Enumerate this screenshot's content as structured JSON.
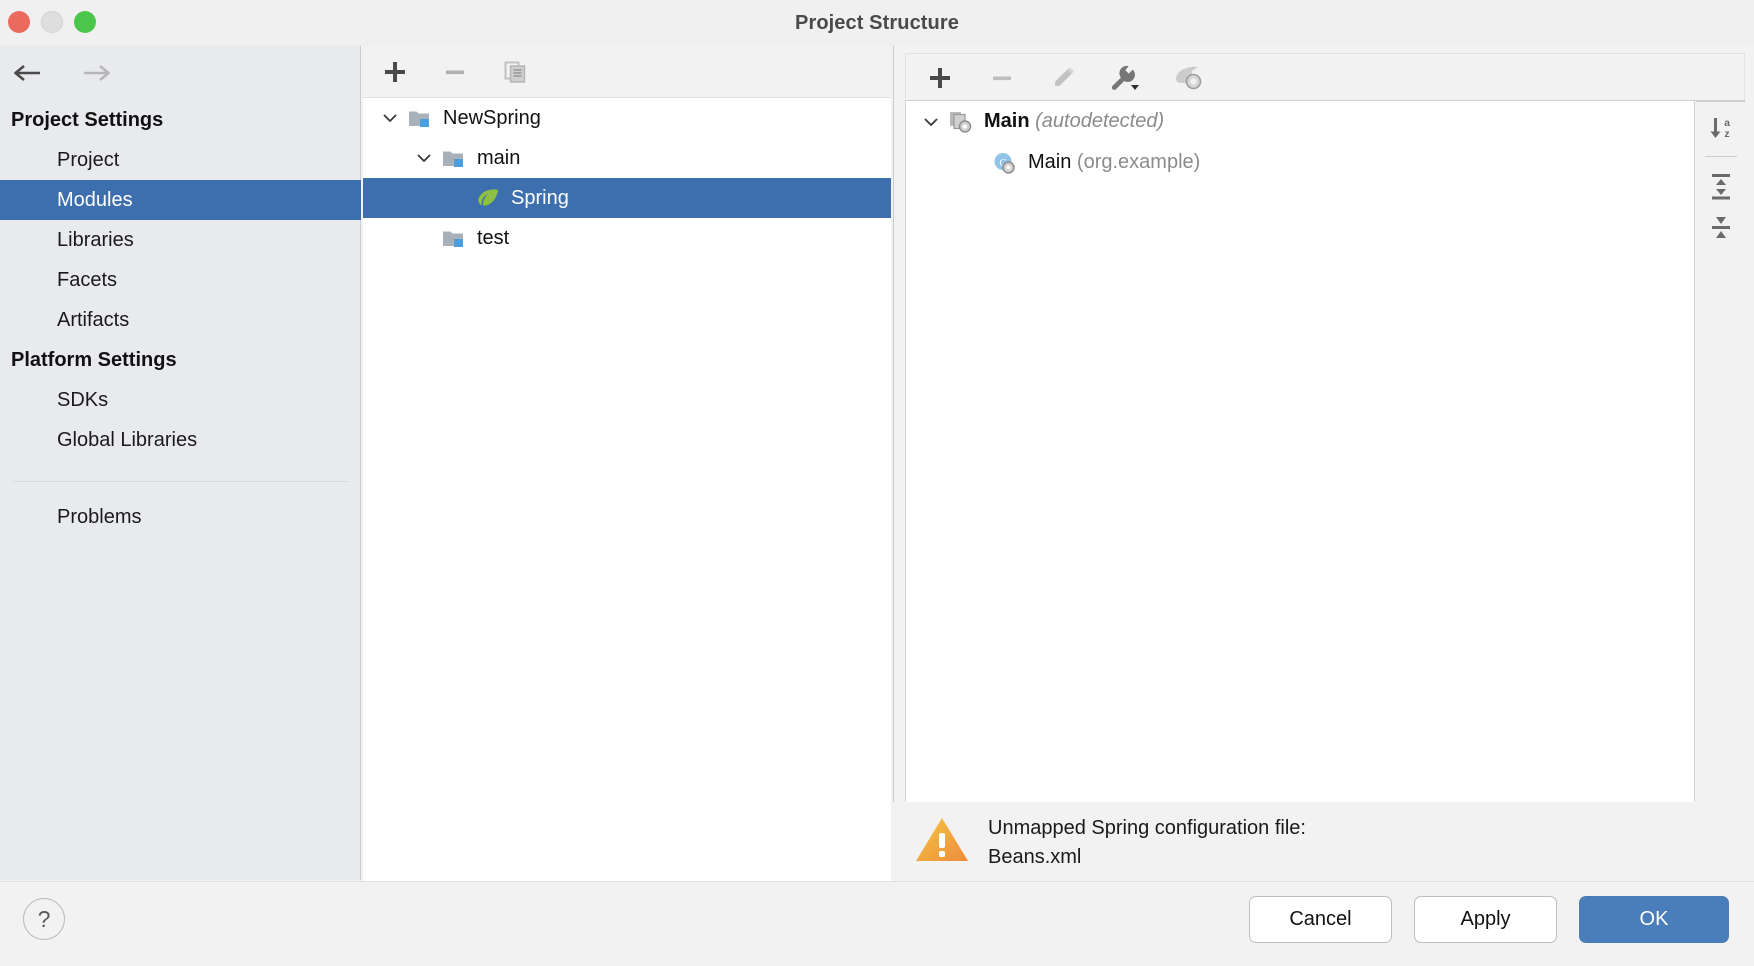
{
  "window": {
    "title": "Project Structure",
    "traffic_lights": [
      "close-button",
      "minimize-button",
      "maximize-button"
    ]
  },
  "nav": {
    "back_icon": "arrow-left-icon",
    "forward_icon": "arrow-right-icon"
  },
  "sidebar": {
    "groups": [
      {
        "title": "Project Settings",
        "items": [
          {
            "label": "Project",
            "selected": false
          },
          {
            "label": "Modules",
            "selected": true
          },
          {
            "label": "Libraries",
            "selected": false
          },
          {
            "label": "Facets",
            "selected": false
          },
          {
            "label": "Artifacts",
            "selected": false
          }
        ]
      },
      {
        "title": "Platform Settings",
        "items": [
          {
            "label": "SDKs",
            "selected": false
          },
          {
            "label": "Global Libraries",
            "selected": false
          }
        ]
      }
    ],
    "problems": {
      "label": "Problems",
      "selected": false
    }
  },
  "modules_panel": {
    "toolbar": [
      {
        "name": "add-module-button",
        "icon": "plus-icon",
        "enabled": true
      },
      {
        "name": "remove-module-button",
        "icon": "minus-icon",
        "enabled": false
      },
      {
        "name": "copy-module-button",
        "icon": "copy-icon",
        "enabled": false
      }
    ],
    "tree": [
      {
        "label": "NewSpring",
        "icon": "module-folder-icon",
        "depth": 0,
        "expanded": true,
        "selected": false
      },
      {
        "label": "main",
        "icon": "source-folder-icon",
        "depth": 1,
        "expanded": true,
        "selected": false
      },
      {
        "label": "Spring",
        "icon": "spring-leaf-icon",
        "depth": 2,
        "expanded": null,
        "selected": true
      },
      {
        "label": "test",
        "icon": "source-folder-icon",
        "depth": 1,
        "expanded": null,
        "selected": false
      }
    ]
  },
  "facet_panel": {
    "toolbar": [
      {
        "name": "add-fileset-button",
        "icon": "plus-icon",
        "enabled": true
      },
      {
        "name": "remove-fileset-button",
        "icon": "minus-icon",
        "enabled": false
      },
      {
        "name": "edit-fileset-button",
        "icon": "pencil-icon",
        "enabled": false
      },
      {
        "name": "configure-button",
        "icon": "wrench-dropdown-icon",
        "enabled": true
      },
      {
        "name": "spring-context-button",
        "icon": "spring-context-icon",
        "enabled": false
      }
    ],
    "side_tools": [
      {
        "name": "sort-alphabetically-button",
        "icon": "sort-az-icon"
      },
      {
        "name": "expand-all-button",
        "icon": "expand-all-icon"
      },
      {
        "name": "collapse-all-button",
        "icon": "collapse-all-icon"
      }
    ],
    "tree": [
      {
        "label": "Main",
        "suffix": "(autodetected)",
        "suffix_style": "italic",
        "icon": "spring-fileset-icon",
        "depth": 0,
        "expanded": true,
        "bold": true
      },
      {
        "label": "Main",
        "suffix": "(org.example)",
        "suffix_style": "normal",
        "icon": "spring-class-icon",
        "depth": 1,
        "expanded": null,
        "bold": false
      }
    ]
  },
  "problem": {
    "icon": "warning-triangle-icon",
    "line1": "Unmapped Spring configuration file:",
    "line2": "Beans.xml"
  },
  "footer": {
    "help_label": "?",
    "buttons": [
      {
        "label": "Cancel",
        "primary": false
      },
      {
        "label": "Apply",
        "primary": false
      },
      {
        "label": "OK",
        "primary": true
      }
    ]
  },
  "colors": {
    "selection_blue": "#3d6ead",
    "primary_button": "#4a7ebb",
    "sidebar_bg": "#e8eaed",
    "panel_bg": "#f2f2f2",
    "warning_orange": "#eead3a",
    "spring_green": "#8bc34a"
  }
}
